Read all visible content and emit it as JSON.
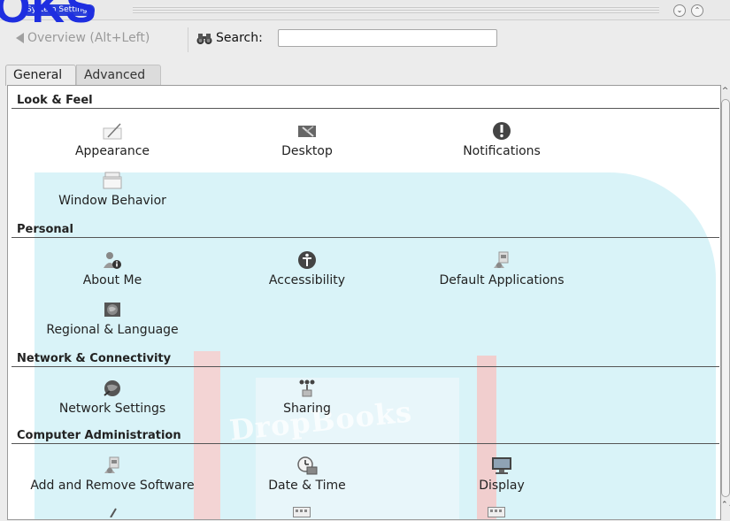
{
  "window": {
    "logo_text": "OKS",
    "title": "System Settings"
  },
  "toolbar": {
    "back_label": "Overview (Alt+Left)",
    "search_label": "Search:",
    "search_value": "",
    "search_placeholder": ""
  },
  "tabs": [
    {
      "label": "General",
      "active": true
    },
    {
      "label": "Advanced",
      "active": false
    }
  ],
  "watermark": {
    "text": "DropBooks"
  },
  "sections": [
    {
      "title": "Look & Feel",
      "items": [
        {
          "label": "Appearance",
          "icon": "appearance-icon"
        },
        {
          "label": "Desktop",
          "icon": "desktop-icon"
        },
        {
          "label": "Notifications",
          "icon": "notifications-icon"
        },
        {
          "label": "Window Behavior",
          "icon": "window-behavior-icon"
        }
      ]
    },
    {
      "title": "Personal",
      "items": [
        {
          "label": "About Me",
          "icon": "about-me-icon"
        },
        {
          "label": "Accessibility",
          "icon": "accessibility-icon"
        },
        {
          "label": "Default Applications",
          "icon": "default-applications-icon"
        },
        {
          "label": "Regional & Language",
          "icon": "regional-language-icon"
        }
      ]
    },
    {
      "title": "Network & Connectivity",
      "items": [
        {
          "label": "Network Settings",
          "icon": "network-settings-icon"
        },
        {
          "label": "Sharing",
          "icon": "sharing-icon"
        }
      ]
    },
    {
      "title": "Computer Administration",
      "items": [
        {
          "label": "Add and Remove Software",
          "icon": "add-remove-software-icon"
        },
        {
          "label": "Date & Time",
          "icon": "date-time-icon"
        },
        {
          "label": "Display",
          "icon": "display-icon"
        }
      ]
    }
  ],
  "colors": {
    "logo": "#1e2ee0",
    "watermark_blob": "#d9f3f8",
    "section_rule": "#555555"
  }
}
